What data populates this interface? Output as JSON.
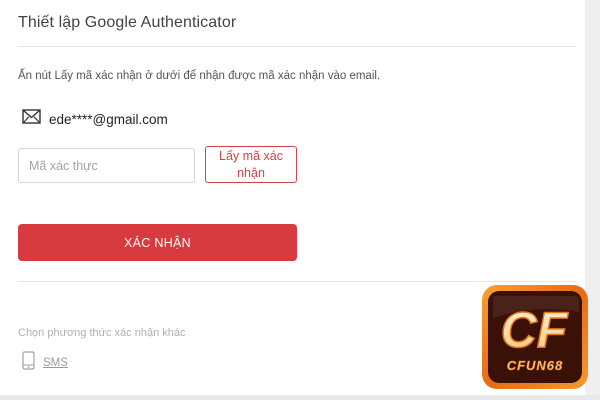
{
  "header": {
    "title": "Thiết lập Google Authenticator"
  },
  "instruction": "Ấn nút Lấy mã xác nhận ở dưới để nhận được mã xác nhận vào email.",
  "email": {
    "icon": "envelope-icon",
    "masked_address": "ede****@gmail.com"
  },
  "code_field": {
    "placeholder": "Mã xác thực",
    "value": ""
  },
  "get_code_button": {
    "label": "Lấy mã xác nhận"
  },
  "confirm_button": {
    "label": "XÁC NHẬN"
  },
  "other_methods": {
    "heading": "Chọn phương thức xác nhận khác",
    "sms": {
      "icon": "mobile-phone-icon",
      "label": "SMS"
    }
  },
  "logo": {
    "text": "CFUN68",
    "monogram": "CF"
  },
  "colors": {
    "accent": "#d83b3f",
    "accent_border": "#d0454a",
    "logo_orange": "#f07a1e",
    "logo_dark": "#3a1106"
  }
}
